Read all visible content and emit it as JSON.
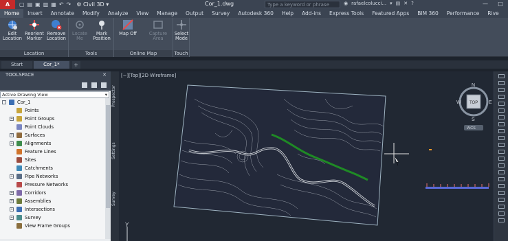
{
  "titlebar": {
    "app_button": "A",
    "app_sub": "C3D",
    "workspace": "Civil 3D",
    "document_title": "Cor_1.dwg",
    "search_placeholder": "Type a keyword or phrase",
    "user_name": "rafaelcolucci...",
    "help_glyph": "?",
    "controls": [
      "—",
      "□",
      "✕"
    ]
  },
  "ribbon_tabs": [
    "Home",
    "Insert",
    "Annotate",
    "Modify",
    "Analyze",
    "View",
    "Manage",
    "Output",
    "Survey",
    "Autodesk 360",
    "Help",
    "Add-ins",
    "Express Tools",
    "Featured Apps",
    "BIM 360",
    "Performance",
    "Rive"
  ],
  "active_ribbon_tab": "Home",
  "ribbon_groups": [
    {
      "label": "Location",
      "buttons": [
        {
          "line1": "Edit",
          "line2": "Location",
          "enabled": true,
          "icon": "globe-gear-icon"
        },
        {
          "line1": "Reorient",
          "line2": "Marker",
          "enabled": true,
          "icon": "marker-icon"
        },
        {
          "line1": "Remove",
          "line2": "Location",
          "enabled": true,
          "icon": "remove-globe-icon"
        }
      ]
    },
    {
      "label": "Tools",
      "buttons": [
        {
          "line1": "Locate",
          "line2": "Me",
          "enabled": false,
          "icon": "locate-icon"
        },
        {
          "line1": "Mark",
          "line2": "Position",
          "enabled": true,
          "icon": "pin-icon"
        }
      ]
    },
    {
      "label": "Online Map",
      "buttons": [
        {
          "line1": "Map Off",
          "line2": "",
          "enabled": true,
          "icon": "map-icon"
        },
        {
          "line1": "Capture",
          "line2": "Area",
          "enabled": false,
          "icon": "capture-icon"
        }
      ]
    },
    {
      "label": "Touch",
      "buttons": [
        {
          "line1": "Select",
          "line2": "Mode",
          "enabled": true,
          "icon": "touch-icon"
        }
      ]
    }
  ],
  "file_tabs": [
    "Start",
    "Cor_1*"
  ],
  "active_file_tab": "Cor_1*",
  "toolspace": {
    "title": "TOOLSPACE",
    "view_select": "Active Drawing View",
    "tree": [
      {
        "label": "Cor_1",
        "level": 0,
        "exp": "-",
        "color": "#3d6fb3"
      },
      {
        "label": "Points",
        "level": 1,
        "exp": "",
        "color": "#c7a43b"
      },
      {
        "label": "Point Groups",
        "level": 1,
        "exp": "+",
        "color": "#c7a43b"
      },
      {
        "label": "Point Clouds",
        "level": 1,
        "exp": "",
        "color": "#7a86c2"
      },
      {
        "label": "Surfaces",
        "level": 1,
        "exp": "+",
        "color": "#8f6a3d"
      },
      {
        "label": "Alignments",
        "level": 1,
        "exp": "+",
        "color": "#3e8c4d"
      },
      {
        "label": "Feature Lines",
        "level": 1,
        "exp": "",
        "color": "#d0732b"
      },
      {
        "label": "Sites",
        "level": 1,
        "exp": "",
        "color": "#9b4b3d"
      },
      {
        "label": "Catchments",
        "level": 1,
        "exp": "",
        "color": "#3d89b8"
      },
      {
        "label": "Pipe Networks",
        "level": 1,
        "exp": "+",
        "color": "#5a6d86"
      },
      {
        "label": "Pressure Networks",
        "level": 1,
        "exp": "",
        "color": "#b84a4a"
      },
      {
        "label": "Corridors",
        "level": 1,
        "exp": "+",
        "color": "#7f6aa8"
      },
      {
        "label": "Assemblies",
        "level": 1,
        "exp": "+",
        "color": "#6d7b3c"
      },
      {
        "label": "Intersections",
        "level": 1,
        "exp": "+",
        "color": "#3d6fb3"
      },
      {
        "label": "Survey",
        "level": 1,
        "exp": "+",
        "color": "#4a8c8c"
      },
      {
        "label": "View Frame Groups",
        "level": 1,
        "exp": "",
        "color": "#8a6e3d"
      }
    ]
  },
  "side_tabs": [
    "Prospector",
    "Settings",
    "Survey"
  ],
  "viewport": {
    "label": "[−][Top][2D Wireframe]",
    "viewcube": {
      "north": "N",
      "south": "S",
      "east": "E",
      "west": "W",
      "top": "TOP",
      "wcs": "WCS"
    },
    "ucs_y": "Y"
  }
}
